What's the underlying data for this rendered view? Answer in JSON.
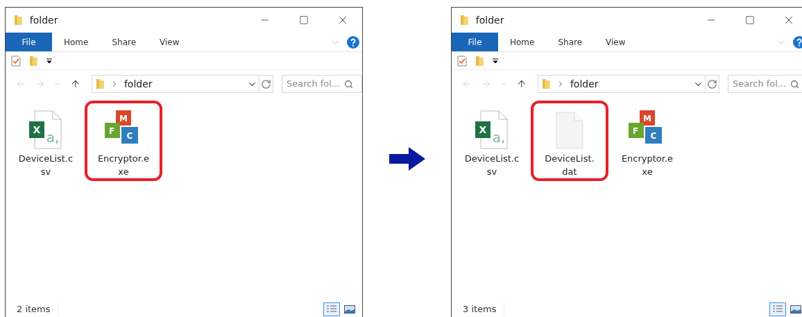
{
  "windows": [
    {
      "title": "folder",
      "ribbon_tabs": [
        {
          "label": "File",
          "selected": true
        },
        {
          "label": "Home",
          "selected": false
        },
        {
          "label": "Share",
          "selected": false
        },
        {
          "label": "View",
          "selected": false
        }
      ],
      "address": "folder",
      "search": {
        "placeholder": "Search fol..."
      },
      "files": [
        {
          "kind": "csv",
          "icon_text": [
            "X",
            "a,"
          ],
          "name_lines": [
            "DeviceList.c",
            "sv"
          ],
          "highlighted": false
        },
        {
          "kind": "exe",
          "icon_text": [
            "M",
            "F",
            "C"
          ],
          "name_lines": [
            "Encryptor.e",
            "xe"
          ],
          "highlighted": true
        }
      ],
      "status": "2 items",
      "views": [
        {
          "kind": "details",
          "selected": true
        },
        {
          "kind": "tiles",
          "selected": false
        }
      ]
    },
    {
      "title": "folder",
      "ribbon_tabs": [
        {
          "label": "File",
          "selected": true
        },
        {
          "label": "Home",
          "selected": false
        },
        {
          "label": "Share",
          "selected": false
        },
        {
          "label": "View",
          "selected": false
        }
      ],
      "address": "folder",
      "search": {
        "placeholder": "Search fol..."
      },
      "files": [
        {
          "kind": "csv",
          "icon_text": [
            "X",
            "a,"
          ],
          "name_lines": [
            "DeviceList.c",
            "sv"
          ],
          "highlighted": false
        },
        {
          "kind": "blank",
          "name_lines": [
            "DeviceList.",
            "dat"
          ],
          "highlighted": true
        },
        {
          "kind": "exe",
          "icon_text": [
            "M",
            "F",
            "C"
          ],
          "name_lines": [
            "Encryptor.e",
            "xe"
          ],
          "highlighted": false
        }
      ],
      "status": "3 items",
      "views": [
        {
          "kind": "details",
          "selected": true
        },
        {
          "kind": "tiles",
          "selected": false
        }
      ]
    }
  ]
}
